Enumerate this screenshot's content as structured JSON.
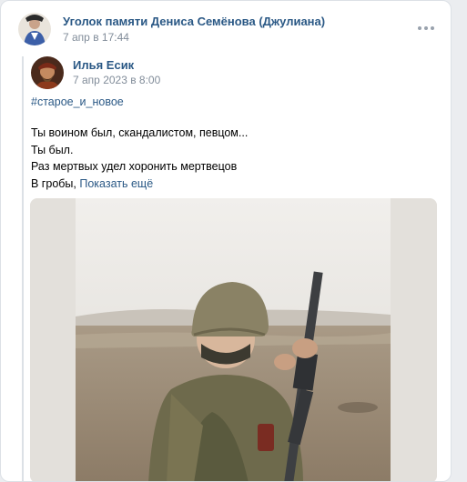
{
  "post": {
    "author": "Уголок памяти Дениса Семёнова (Джулиана)",
    "date": "7 апр в 17:44",
    "more_icon": "more-horizontal-icon"
  },
  "repost": {
    "author": "Илья Есик",
    "date": "7 апр 2023 в 8:00",
    "hashtag": "#старое_и_новое",
    "lines": [
      "Ты воином был, скандалистом, певцом...",
      "Ты был.",
      "Раз мертвых удел хоронить мертвецов",
      "В гробы,"
    ],
    "show_more": "Показать ещё"
  },
  "colors": {
    "link": "#2a5885",
    "secondary": "#818c99",
    "background": "#ebedf0"
  }
}
